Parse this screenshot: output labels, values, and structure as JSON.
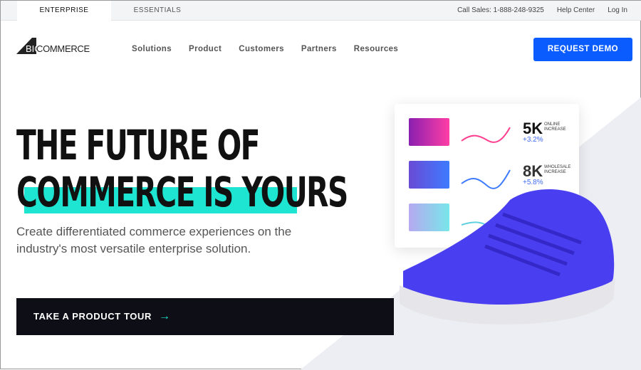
{
  "topbar": {
    "tabs": [
      {
        "label": "ENTERPRISE",
        "active": true
      },
      {
        "label": "ESSENTIALS",
        "active": false
      }
    ],
    "call_sales": "Call Sales: 1-888-248-9325",
    "help": "Help Center",
    "login": "Log In"
  },
  "header": {
    "logo": {
      "big": "BIG",
      "commerce": "COMMERCE"
    },
    "nav": [
      "Solutions",
      "Product",
      "Customers",
      "Partners",
      "Resources"
    ],
    "cta": "REQUEST DEMO",
    "cta_color": "#0b5cff"
  },
  "hero": {
    "title_line1": "THE FUTURE OF",
    "title_line2": "COMMERCE IS YOURS",
    "highlight_color": "#1ee5d2",
    "subtitle": "Create differentiated commerce experiences on the industry's most versatile enterprise solution.",
    "tour_button": "TAKE A PRODUCT TOUR",
    "tour_arrow": "→"
  },
  "stats": [
    {
      "value": "5K",
      "label": "ONLINE INCREASE",
      "change": "+3.2%"
    },
    {
      "value": "8K",
      "label": "WHOLESALE INCREASE",
      "change": "+5.8%"
    }
  ]
}
